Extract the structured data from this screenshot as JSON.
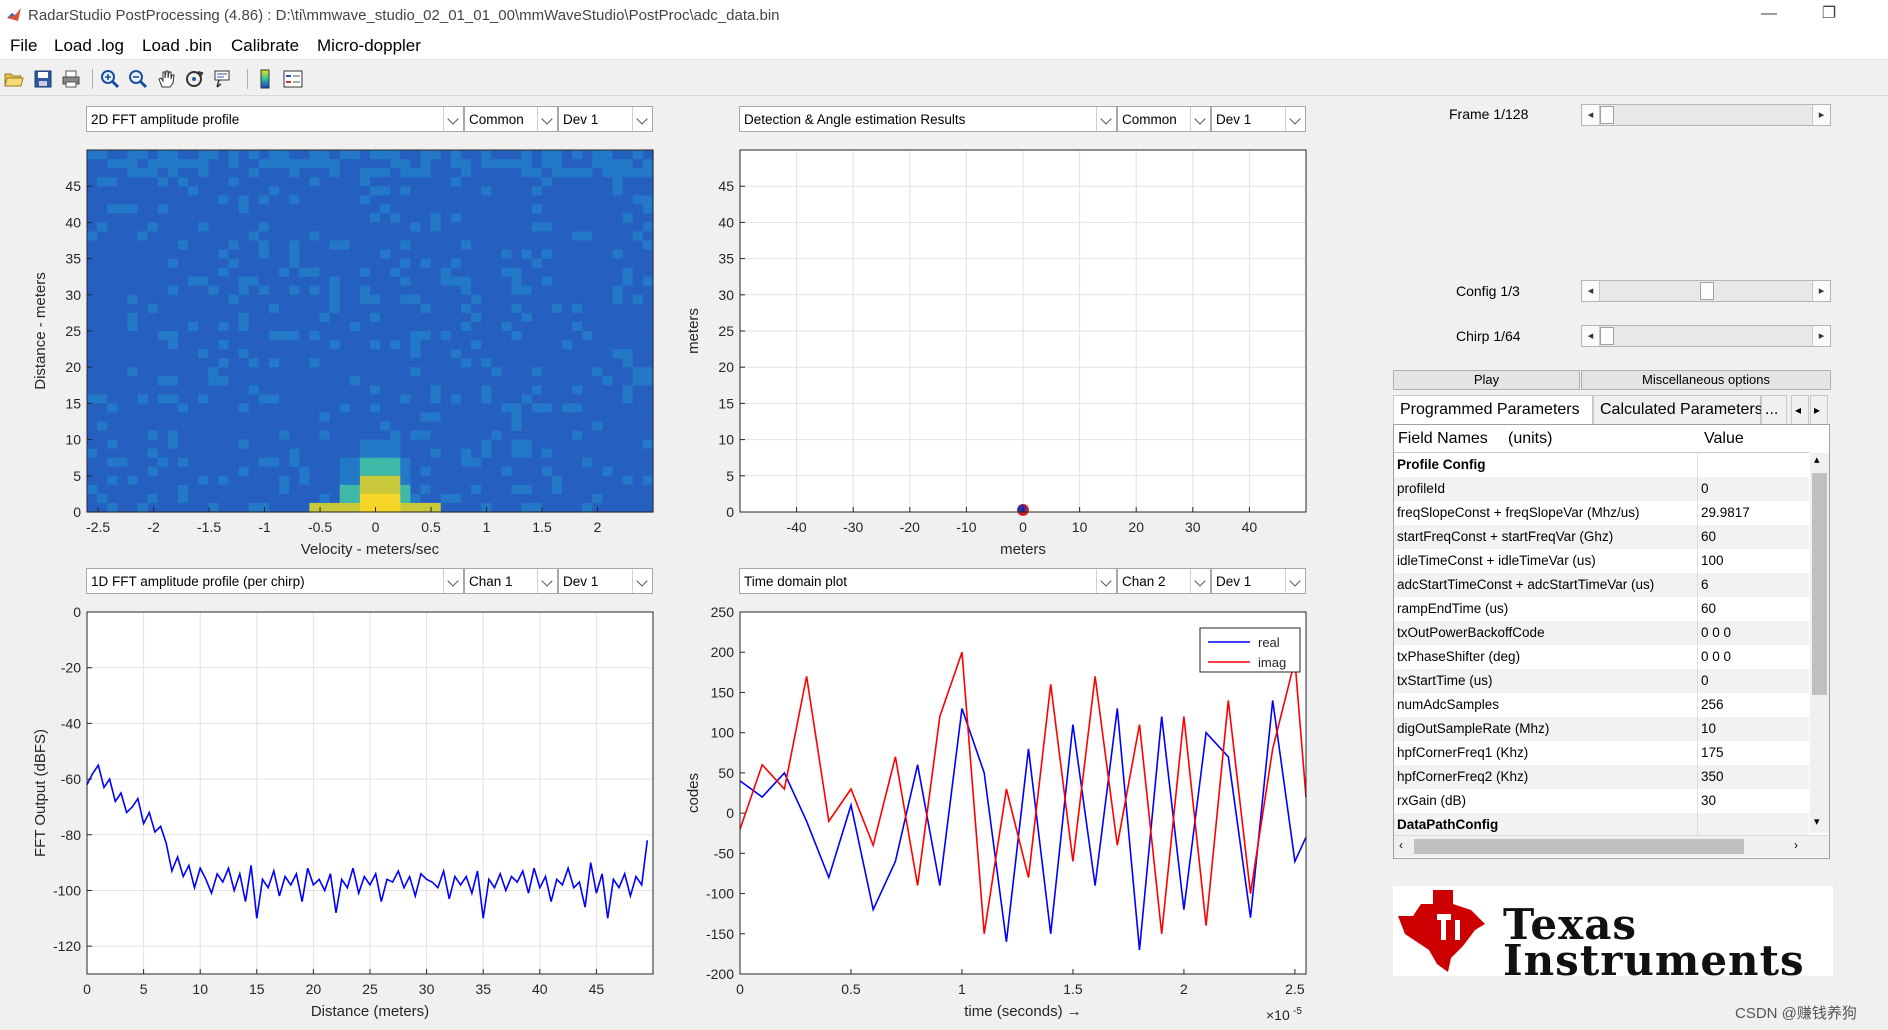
{
  "window": {
    "title": "RadarStudio PostProcessing (4.86)  : D:\\ti\\mmwave_studio_02_01_01_00\\mmWaveStudio\\PostProc\\adc_data.bin",
    "minimize": "—",
    "restore": "❐"
  },
  "menu": [
    "File",
    "Load .log",
    "Load .bin",
    "Calibrate",
    "Micro-doppler"
  ],
  "toolbar_icons": [
    "open-icon",
    "save-icon",
    "print-icon",
    "zoom-in-icon",
    "zoom-out-icon",
    "pan-icon",
    "rotate-icon",
    "data-cursor-icon",
    "colorbar-icon",
    "legend-icon"
  ],
  "panels": {
    "tl": {
      "view": "2D FFT amplitude profile",
      "chan": "Common",
      "dev": "Dev 1"
    },
    "tr": {
      "view": "Detection & Angle estimation Results",
      "chan": "Common",
      "dev": "Dev 1"
    },
    "bl": {
      "view": "1D FFT amplitude profile (per chirp)",
      "chan": "Chan 1",
      "dev": "Dev 1"
    },
    "br": {
      "view": "Time domain plot",
      "chan": "Chan 2",
      "dev": "Dev 1"
    }
  },
  "controls": {
    "frame_label": "Frame 1/128",
    "frame_position": 0.0,
    "config_label": "Config 1/3",
    "config_position": 0.5,
    "chirp_label": "Chirp 1/64",
    "chirp_position": 0.0,
    "play_label": "Play",
    "misc_label": "Miscellaneous options"
  },
  "tabs": {
    "programmed": "Programmed Parameters",
    "calculated": "Calculated Parameters",
    "more": "...",
    "left": "◂",
    "right": "▸"
  },
  "table": {
    "header_field": "Field Names",
    "header_units": "(units)",
    "header_value": "Value",
    "rows": [
      {
        "field": "Profile Config",
        "value": "",
        "section": true
      },
      {
        "field": "profileId",
        "value": "0"
      },
      {
        "field": "freqSlopeConst + freqSlopeVar (Mhz/us)",
        "value": "29.9817"
      },
      {
        "field": "startFreqConst + startFreqVar (Ghz)",
        "value": "60"
      },
      {
        "field": "idleTimeConst + idleTimeVar (us)",
        "value": "100"
      },
      {
        "field": "adcStartTimeConst + adcStartTimeVar (us)",
        "value": "6"
      },
      {
        "field": "rampEndTime (us)",
        "value": "60"
      },
      {
        "field": "txOutPowerBackoffCode",
        "value": "0 0 0"
      },
      {
        "field": "txPhaseShifter (deg)",
        "value": "0 0 0"
      },
      {
        "field": "txStartTime (us)",
        "value": "0"
      },
      {
        "field": "numAdcSamples",
        "value": "256"
      },
      {
        "field": "digOutSampleRate (Mhz)",
        "value": "10"
      },
      {
        "field": "hpfCornerFreq1 (Khz)",
        "value": "175"
      },
      {
        "field": "hpfCornerFreq2 (Khz)",
        "value": "350"
      },
      {
        "field": "rxGain (dB)",
        "value": "30"
      },
      {
        "field": "DataPathConfig",
        "value": "",
        "section": true
      }
    ]
  },
  "logo": {
    "line1": "Texas",
    "line2": "Instruments"
  },
  "watermark": "CSDN @赚钱养狗",
  "chart_data": [
    {
      "type": "heatmap",
      "xlabel": "Velocity - meters/sec",
      "ylabel": "Distance - meters",
      "xlim": [
        -2.6,
        2.5
      ],
      "ylim": [
        0,
        50
      ],
      "xticks": [
        -2.5,
        -2,
        -1.5,
        -1,
        -0.5,
        0,
        0.5,
        1,
        1.5,
        2
      ],
      "yticks": [
        0,
        5,
        10,
        15,
        20,
        25,
        30,
        35,
        40,
        45
      ],
      "hotspot": {
        "velocity": 0,
        "distance_range": [
          0,
          10
        ]
      }
    },
    {
      "type": "scatter",
      "xlabel": "meters",
      "ylabel": "meters",
      "xlim": [
        -50,
        50
      ],
      "ylim": [
        0,
        50
      ],
      "xticks": [
        -40,
        -30,
        -20,
        -10,
        0,
        10,
        20,
        30,
        40
      ],
      "yticks": [
        0,
        5,
        10,
        15,
        20,
        25,
        30,
        35,
        40,
        45
      ],
      "grid": true,
      "points": [
        {
          "x": 0,
          "y": 0.3
        }
      ]
    },
    {
      "type": "line",
      "xlabel": "Distance (meters)",
      "ylabel": "FFT Output (dBFS)",
      "xlim": [
        0,
        50
      ],
      "ylim": [
        -130,
        0
      ],
      "xticks": [
        0,
        5,
        10,
        15,
        20,
        25,
        30,
        35,
        40,
        45
      ],
      "yticks": [
        0,
        -20,
        -40,
        -60,
        -80,
        -100,
        -120
      ],
      "grid": true,
      "series": [
        {
          "x": [
            0,
            0.5,
            1,
            1.5,
            2,
            2.5,
            3,
            3.5,
            4,
            4.5,
            5,
            5.5,
            6,
            6.5,
            7,
            7.5,
            8,
            8.5,
            9,
            9.5,
            10,
            10.5,
            11,
            11.5,
            12,
            12.5,
            13,
            13.5,
            14,
            14.5,
            15,
            15.5,
            16,
            16.5,
            17,
            17.5,
            18,
            18.5,
            19,
            19.5,
            20,
            20.5,
            21,
            21.5,
            22,
            22.5,
            23,
            23.5,
            24,
            24.5,
            25,
            25.5,
            26,
            26.5,
            27,
            27.5,
            28,
            28.5,
            29,
            29.5,
            30,
            30.5,
            31,
            31.5,
            32,
            32.5,
            33,
            33.5,
            34,
            34.5,
            35,
            35.5,
            36,
            36.5,
            37,
            37.5,
            38,
            38.5,
            39,
            39.5,
            40,
            40.5,
            41,
            41.5,
            42,
            42.5,
            43,
            43.5,
            44,
            44.5,
            45,
            45.5,
            46,
            46.5,
            47,
            47.5,
            48,
            48.5,
            49,
            49.5
          ],
          "values": [
            -62,
            -58,
            -55,
            -63,
            -60,
            -68,
            -65,
            -72,
            -70,
            -67,
            -76,
            -72,
            -79,
            -77,
            -83,
            -93,
            -88,
            -95,
            -91,
            -99,
            -92,
            -96,
            -101,
            -94,
            -97,
            -92,
            -100,
            -94,
            -104,
            -91,
            -110,
            -96,
            -99,
            -93,
            -102,
            -95,
            -98,
            -94,
            -104,
            -92,
            -98,
            -96,
            -100,
            -94,
            -108,
            -96,
            -99,
            -92,
            -101,
            -95,
            -98,
            -94,
            -104,
            -96,
            -97,
            -93,
            -99,
            -95,
            -102,
            -94,
            -96,
            -97,
            -99,
            -93,
            -103,
            -95,
            -98,
            -95,
            -101,
            -93,
            -110,
            -96,
            -99,
            -94,
            -100,
            -95,
            -97,
            -93,
            -101,
            -92,
            -99,
            -95,
            -104,
            -96,
            -98,
            -92,
            -99,
            -97,
            -106,
            -90,
            -101,
            -94,
            -110,
            -96,
            -99,
            -94,
            -102,
            -95,
            -98,
            -82
          ]
        }
      ]
    },
    {
      "type": "line",
      "xlabel": "time  (seconds) →",
      "ylabel": "codes",
      "x_multiplier": "×10",
      "x_multiplier_exp": "-5",
      "xlim": [
        0,
        2.55
      ],
      "ylim": [
        -200,
        250
      ],
      "xticks": [
        0,
        0.5,
        1,
        1.5,
        2,
        2.5
      ],
      "yticks": [
        250,
        200,
        150,
        100,
        50,
        0,
        -50,
        -100,
        -150,
        -200
      ],
      "legend": "top-right",
      "series": [
        {
          "name": "real",
          "color": "#0000ff",
          "x": [
            0,
            0.1,
            0.2,
            0.3,
            0.4,
            0.5,
            0.6,
            0.7,
            0.8,
            0.9,
            1.0,
            1.1,
            1.2,
            1.3,
            1.4,
            1.5,
            1.6,
            1.7,
            1.8,
            1.9,
            2.0,
            2.1,
            2.2,
            2.3,
            2.4,
            2.5,
            2.55
          ],
          "values": [
            40,
            20,
            50,
            -10,
            -80,
            10,
            -120,
            -60,
            60,
            -90,
            130,
            50,
            -160,
            80,
            -150,
            110,
            -90,
            130,
            -170,
            120,
            -120,
            100,
            70,
            -130,
            140,
            -60,
            -30
          ]
        },
        {
          "name": "imag",
          "color": "#ff0000",
          "x": [
            0,
            0.1,
            0.2,
            0.3,
            0.4,
            0.5,
            0.6,
            0.7,
            0.8,
            0.9,
            1.0,
            1.1,
            1.2,
            1.3,
            1.4,
            1.5,
            1.6,
            1.7,
            1.8,
            1.9,
            2.0,
            2.1,
            2.2,
            2.3,
            2.4,
            2.5,
            2.55
          ],
          "values": [
            -20,
            60,
            30,
            170,
            -10,
            30,
            -40,
            70,
            -90,
            120,
            200,
            -150,
            30,
            -80,
            160,
            -60,
            170,
            -40,
            110,
            -150,
            120,
            -140,
            140,
            -100,
            80,
            190,
            20
          ]
        }
      ]
    }
  ]
}
